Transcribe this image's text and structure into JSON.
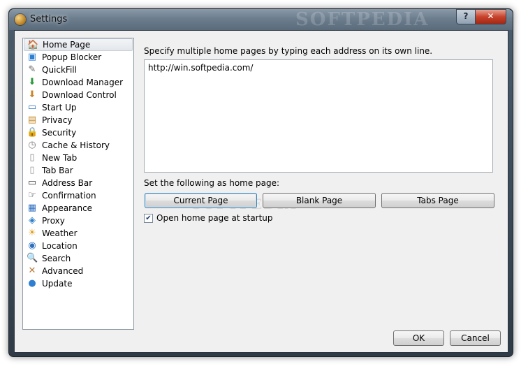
{
  "window": {
    "title": "Settings"
  },
  "titlebar": {
    "help_glyph": "?",
    "close_glyph": "✕",
    "watermark": "SOFTPEDIA"
  },
  "sidebar": {
    "items": [
      {
        "label": "Home Page",
        "icon": "home-icon",
        "glyph": "🏠",
        "color": "#5a6e9a",
        "selected": true
      },
      {
        "label": "Popup Blocker",
        "icon": "popup-blocker-icon",
        "glyph": "▣",
        "color": "#2f7fd0"
      },
      {
        "label": "QuickFill",
        "icon": "quickfill-icon",
        "glyph": "✎",
        "color": "#6b6b6b"
      },
      {
        "label": "Download Manager",
        "icon": "download-manager-icon",
        "glyph": "⬇",
        "color": "#2c9a3a"
      },
      {
        "label": "Download Control",
        "icon": "download-control-icon",
        "glyph": "⬇",
        "color": "#c8852a"
      },
      {
        "label": "Start Up",
        "icon": "start-up-icon",
        "glyph": "▭",
        "color": "#2f6fc0"
      },
      {
        "label": "Privacy",
        "icon": "privacy-icon",
        "glyph": "▤",
        "color": "#c58a2a"
      },
      {
        "label": "Security",
        "icon": "security-icon",
        "glyph": "🔒",
        "color": "#c99a2e"
      },
      {
        "label": "Cache & History",
        "icon": "cache-history-icon",
        "glyph": "◷",
        "color": "#7a7a7a"
      },
      {
        "label": "New Tab",
        "icon": "new-tab-icon",
        "glyph": "▯",
        "color": "#8a8a8a"
      },
      {
        "label": "Tab Bar",
        "icon": "tab-bar-icon",
        "glyph": "▯",
        "color": "#9a9a9a"
      },
      {
        "label": "Address Bar",
        "icon": "address-bar-icon",
        "glyph": "▭",
        "color": "#333333"
      },
      {
        "label": "Confirmation",
        "icon": "confirmation-icon",
        "glyph": "☞",
        "color": "#333333"
      },
      {
        "label": "Appearance",
        "icon": "appearance-icon",
        "glyph": "▦",
        "color": "#2f6fc0"
      },
      {
        "label": "Proxy",
        "icon": "proxy-icon",
        "glyph": "◈",
        "color": "#2c7fc8"
      },
      {
        "label": "Weather",
        "icon": "weather-icon",
        "glyph": "☀",
        "color": "#e0a020"
      },
      {
        "label": "Location",
        "icon": "location-icon",
        "glyph": "◉",
        "color": "#2f6fc0"
      },
      {
        "label": "Search",
        "icon": "search-icon",
        "glyph": "🔍",
        "color": "#2f6fc0"
      },
      {
        "label": "Advanced",
        "icon": "advanced-icon",
        "glyph": "✕",
        "color": "#b87b3a"
      },
      {
        "label": "Update",
        "icon": "update-icon",
        "glyph": "●",
        "color": "#2f7fd0"
      }
    ]
  },
  "main": {
    "instructions": "Specify multiple home pages by typing each address on its own line.",
    "home_pages_value": "http://win.softpedia.com/",
    "set_as_label": "Set the following as home page:",
    "buttons": {
      "current_page": "Current Page",
      "blank_page": "Blank Page",
      "tabs_page": "Tabs Page"
    },
    "open_at_startup": {
      "label": "Open home page at startup",
      "checked": true,
      "check_glyph": "✔"
    },
    "watermark": "SOFTPEDIA"
  },
  "footer": {
    "ok_label": "OK",
    "cancel_label": "Cancel"
  }
}
